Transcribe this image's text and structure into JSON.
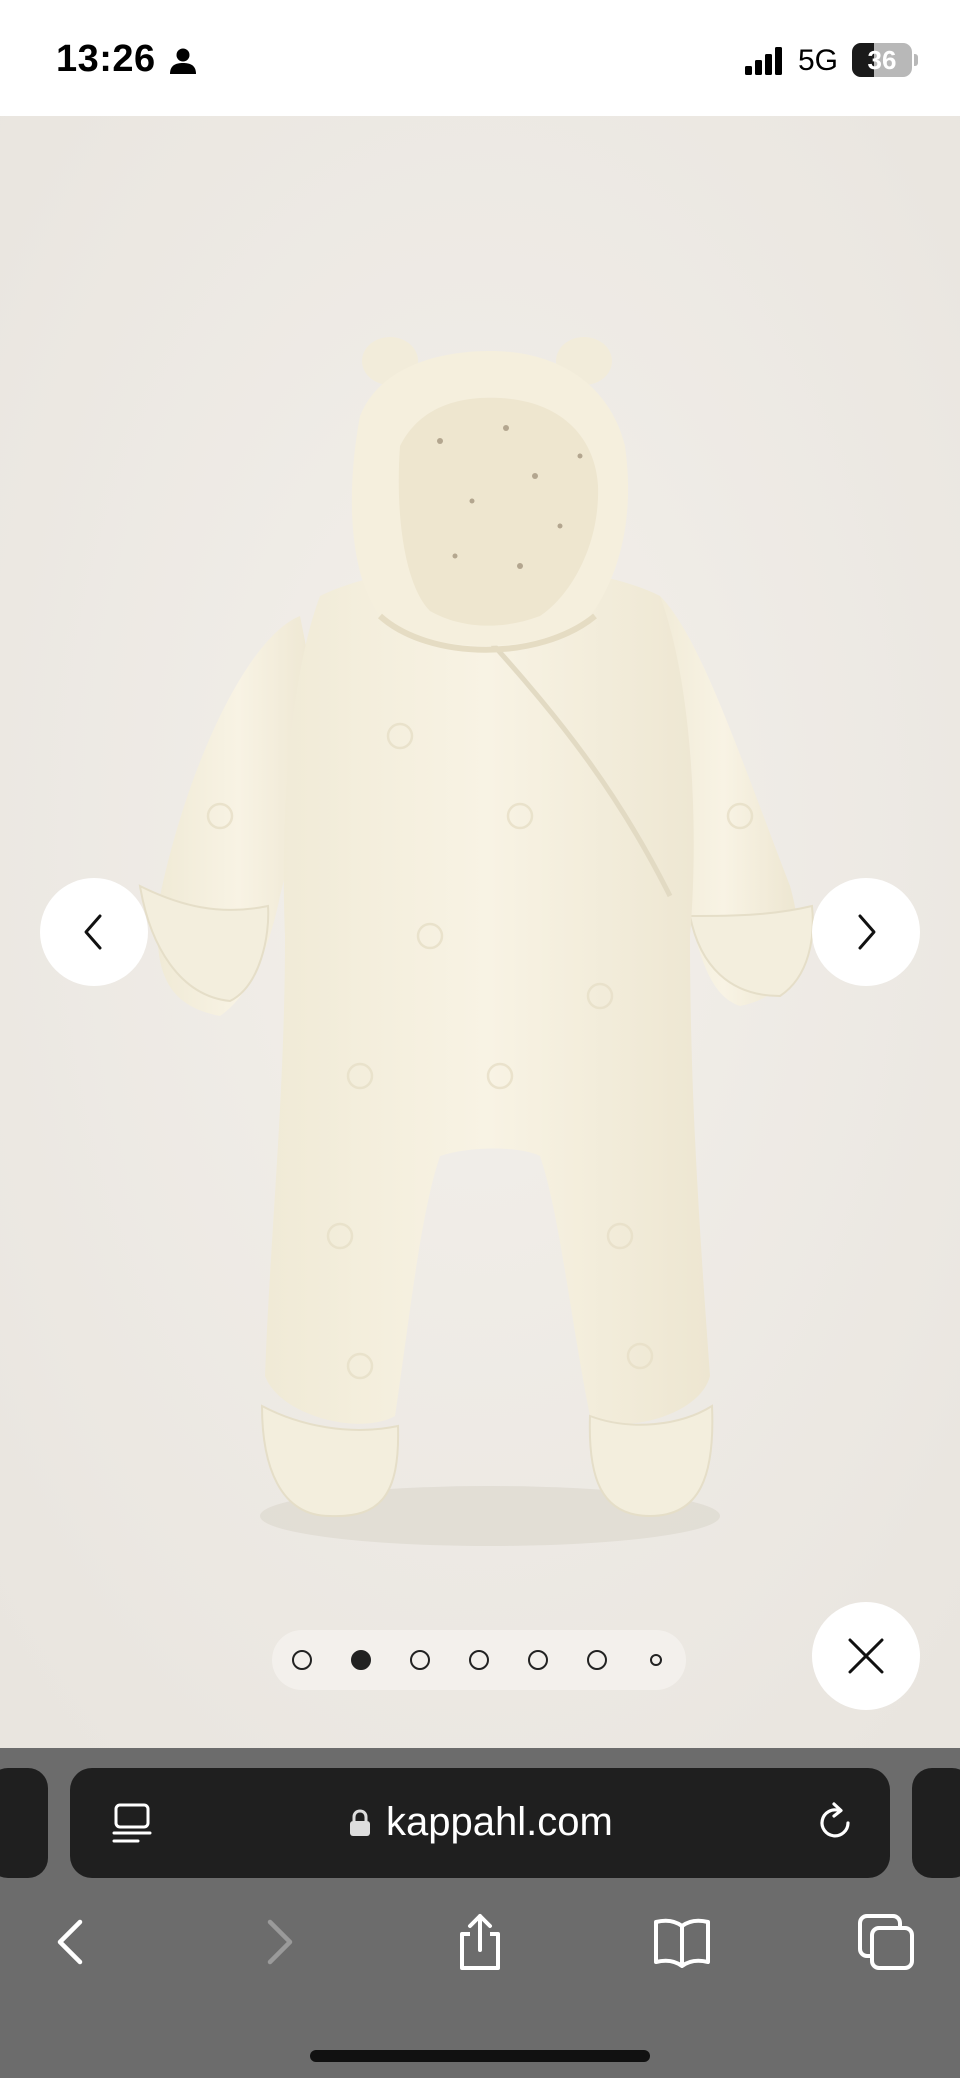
{
  "status_bar": {
    "time": "13:26",
    "network": "5G",
    "battery": "36",
    "battery_level": 0.36
  },
  "gallery": {
    "product_image_alt": "Cream hooded baby pram suit with bear ears",
    "slide_count": 7,
    "active_slide": 2,
    "colors": {
      "background": "#eeebe6",
      "garment": "#f5f0e1"
    }
  },
  "browser": {
    "url": "kappahl.com",
    "icons": [
      "reader-icon",
      "lock-icon",
      "reload-icon",
      "back-icon",
      "forward-icon",
      "share-icon",
      "bookmarks-icon",
      "tabs-icon"
    ]
  }
}
